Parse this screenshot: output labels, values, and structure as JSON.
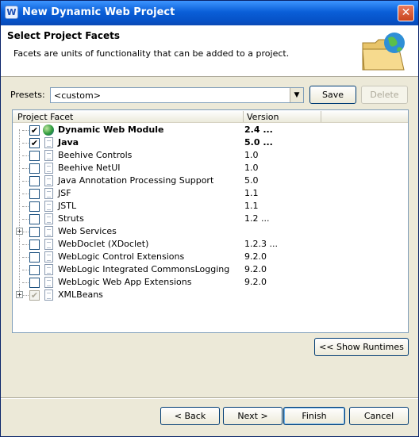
{
  "window": {
    "title": "New Dynamic Web Project",
    "title_icon": "W",
    "close_glyph": "✕"
  },
  "header": {
    "title": "Select Project Facets",
    "description": "Facets are units of functionality that can be added to a project.",
    "icon": "folder-globe-icon"
  },
  "presets": {
    "label": "Presets:",
    "value": "<custom>",
    "save_label": "Save",
    "delete_label": "Delete"
  },
  "table": {
    "columns": [
      "Project Facet",
      "Version"
    ],
    "rows": [
      {
        "name": "Dynamic Web Module",
        "version": "2.4 ...",
        "checked": "✔",
        "bold": true,
        "icon": "globe-icon"
      },
      {
        "name": "Java",
        "version": "5.0 ...",
        "checked": "✔",
        "bold": true,
        "icon": "file-icon"
      },
      {
        "name": "Beehive Controls",
        "version": "1.0",
        "checked": "",
        "bold": false,
        "icon": "file-icon"
      },
      {
        "name": "Beehive NetUI",
        "version": "1.0",
        "checked": "",
        "bold": false,
        "icon": "file-icon"
      },
      {
        "name": "Java Annotation Processing Support",
        "version": "5.0",
        "checked": "",
        "bold": false,
        "icon": "file-icon"
      },
      {
        "name": "JSF",
        "version": "1.1",
        "checked": "",
        "bold": false,
        "icon": "file-icon"
      },
      {
        "name": "JSTL",
        "version": "1.1",
        "checked": "",
        "bold": false,
        "icon": "file-icon"
      },
      {
        "name": "Struts",
        "version": "1.2 ...",
        "checked": "",
        "bold": false,
        "icon": "file-icon"
      },
      {
        "name": "Web Services",
        "version": "",
        "checked": "",
        "bold": false,
        "icon": "file-icon",
        "expandable": true
      },
      {
        "name": "WebDoclet (XDoclet)",
        "version": "1.2.3 ...",
        "checked": "",
        "bold": false,
        "icon": "file-icon"
      },
      {
        "name": "WebLogic Control Extensions",
        "version": "9.2.0",
        "checked": "",
        "bold": false,
        "icon": "file-icon"
      },
      {
        "name": "WebLogic Integrated CommonsLogging",
        "version": "9.2.0",
        "checked": "",
        "bold": false,
        "icon": "file-icon"
      },
      {
        "name": "WebLogic Web App Extensions",
        "version": "9.2.0",
        "checked": "",
        "bold": false,
        "icon": "file-icon"
      },
      {
        "name": "XMLBeans",
        "version": "",
        "checked": "✔",
        "bold": false,
        "icon": "file-icon",
        "expandable": true,
        "greyed": true
      }
    ]
  },
  "show_runtimes_label": "<< Show Runtimes",
  "footer": {
    "back_label": "< Back",
    "next_label": "Next >",
    "finish_label": "Finish",
    "cancel_label": "Cancel"
  },
  "expander_glyph": "+"
}
